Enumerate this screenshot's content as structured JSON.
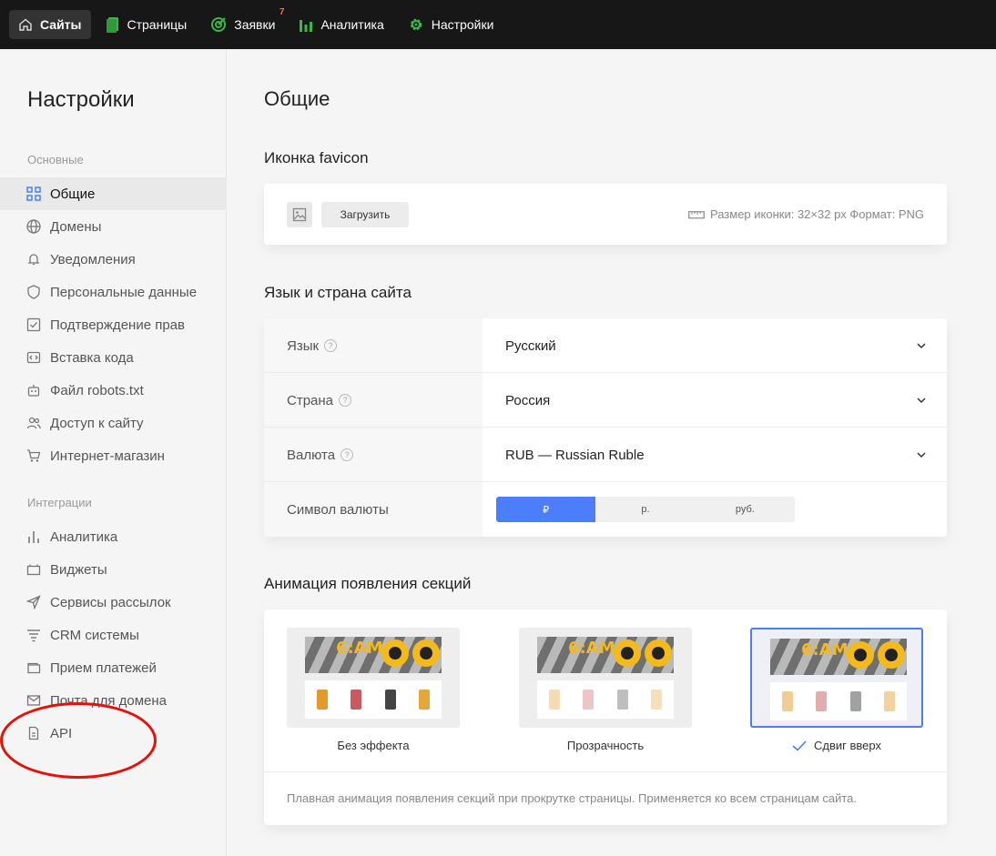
{
  "topbar": {
    "items": [
      {
        "label": "Сайты",
        "icon": "home-icon",
        "active": true
      },
      {
        "label": "Страницы",
        "icon": "pages-icon"
      },
      {
        "label": "Заявки",
        "icon": "target-icon",
        "badge": "7"
      },
      {
        "label": "Аналитика",
        "icon": "bar-chart-icon"
      },
      {
        "label": "Настройки",
        "icon": "gear-icon"
      }
    ]
  },
  "sidebar": {
    "title": "Настройки",
    "section_main": "Основные",
    "main_items": [
      {
        "label": "Общие",
        "icon": "grid-icon"
      },
      {
        "label": "Домены",
        "icon": "globe-icon"
      },
      {
        "label": "Уведомления",
        "icon": "bell-icon"
      },
      {
        "label": "Персональные данные",
        "icon": "shield-icon"
      },
      {
        "label": "Подтверждение прав",
        "icon": "checkbox-icon"
      },
      {
        "label": "Вставка кода",
        "icon": "code-icon"
      },
      {
        "label": "Файл robots.txt",
        "icon": "robot-icon"
      },
      {
        "label": "Доступ к сайту",
        "icon": "users-icon"
      },
      {
        "label": "Интернет-магазин",
        "icon": "cart-icon"
      }
    ],
    "section_integrations": "Интеграции",
    "integration_items": [
      {
        "label": "Аналитика",
        "icon": "bar-chart-icon"
      },
      {
        "label": "Виджеты",
        "icon": "widget-icon"
      },
      {
        "label": "Сервисы рассылок",
        "icon": "send-icon"
      },
      {
        "label": "CRM системы",
        "icon": "filter-icon"
      },
      {
        "label": "Прием платежей",
        "icon": "wallet-icon"
      },
      {
        "label": "Почта для домена",
        "icon": "mail-icon"
      },
      {
        "label": "API",
        "icon": "file-icon"
      }
    ]
  },
  "main": {
    "title": "Общие",
    "favicon": {
      "heading": "Иконка favicon",
      "upload_label": "Загрузить",
      "size_info": "Размер иконки: 32×32 px Формат: PNG"
    },
    "language": {
      "heading": "Язык и страна сайта",
      "rows": [
        {
          "label": "Язык",
          "value": "Русский"
        },
        {
          "label": "Страна",
          "value": "Россия"
        },
        {
          "label": "Валюта",
          "value": "RUB — Russian Ruble"
        }
      ],
      "symbol_label": "Символ валюты",
      "symbol_options": [
        "₽",
        "р.",
        "руб."
      ],
      "symbol_selected": "₽"
    },
    "animation": {
      "heading": "Анимация появления секций",
      "options": [
        {
          "label": "Без эффекта"
        },
        {
          "label": "Прозрачность"
        },
        {
          "label": "Сдвиг вверх",
          "selected": true
        }
      ],
      "thumb_text": "6:AM",
      "description": "Плавная анимация появления секций при прокрутке страницы. Применяется ко всем страницам сайта."
    }
  },
  "colors": {
    "accent": "#4c7dfa",
    "topbar_bg": "#171717",
    "badge": "#ff6b3d",
    "icon_green": "#3cb54a",
    "annotation_red": "#e3120b"
  }
}
